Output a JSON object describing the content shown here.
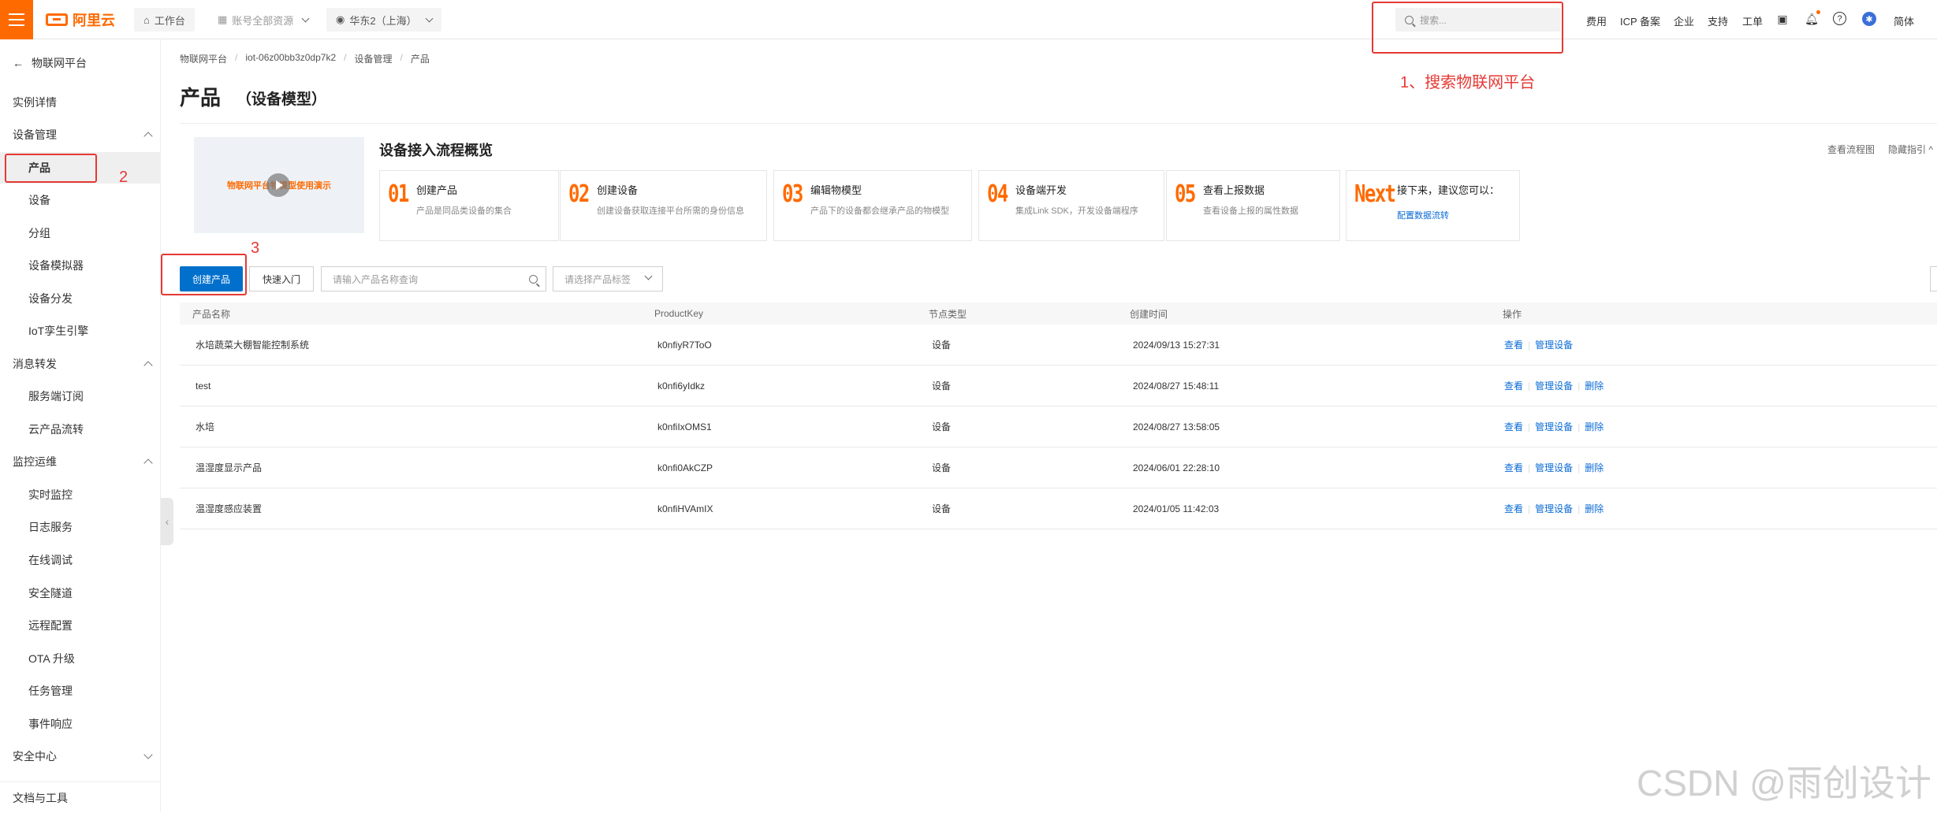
{
  "topbar": {
    "logo_text": "阿里云",
    "workbench": "工作台",
    "account_resources": "账号全部资源",
    "region": "华东2（上海）",
    "search_placeholder": "搜索...",
    "links": [
      "费用",
      "ICP 备案",
      "企业",
      "支持",
      "工单"
    ],
    "language": "简体"
  },
  "sidebar": {
    "back_label": "物联网平台",
    "items": [
      {
        "label": "实例详情",
        "type": "group"
      },
      {
        "label": "设备管理",
        "type": "group",
        "state": "expanded"
      },
      {
        "label": "产品",
        "type": "sub",
        "active": true
      },
      {
        "label": "设备",
        "type": "sub"
      },
      {
        "label": "分组",
        "type": "sub"
      },
      {
        "label": "设备模拟器",
        "type": "sub"
      },
      {
        "label": "设备分发",
        "type": "sub"
      },
      {
        "label": "IoT孪生引擎",
        "type": "sub"
      },
      {
        "label": "消息转发",
        "type": "group",
        "state": "expanded"
      },
      {
        "label": "服务端订阅",
        "type": "sub"
      },
      {
        "label": "云产品流转",
        "type": "sub"
      },
      {
        "label": "监控运维",
        "type": "group",
        "state": "expanded"
      },
      {
        "label": "实时监控",
        "type": "sub"
      },
      {
        "label": "日志服务",
        "type": "sub"
      },
      {
        "label": "在线调试",
        "type": "sub"
      },
      {
        "label": "安全隧道",
        "type": "sub"
      },
      {
        "label": "远程配置",
        "type": "sub"
      },
      {
        "label": "OTA 升级",
        "type": "sub"
      },
      {
        "label": "任务管理",
        "type": "sub"
      },
      {
        "label": "事件响应",
        "type": "sub"
      },
      {
        "label": "安全中心",
        "type": "group",
        "state": "collapsed"
      },
      {
        "label": "文档与工具",
        "type": "group"
      }
    ]
  },
  "breadcrumb": [
    "物联网平台",
    "iot-06z00bb3z0dp7k2",
    "设备管理",
    "产品"
  ],
  "page": {
    "title": "产品",
    "subtitle": "（设备模型）"
  },
  "overview": {
    "video_text": "物联网平台物模型使用演示",
    "title": "设备接入流程概览",
    "view_flow": "查看流程图",
    "hide_guide": "隐藏指引 ^",
    "steps": [
      {
        "num": "01",
        "title": "创建产品",
        "desc": "产品是同品类设备的集合"
      },
      {
        "num": "02",
        "title": "创建设备",
        "desc": "创建设备获取连接平台所需的身份信息"
      },
      {
        "num": "03",
        "title": "编辑物模型",
        "desc": "产品下的设备都会继承产品的物模型"
      },
      {
        "num": "04",
        "title": "设备端开发",
        "desc": "集成Link SDK，开发设备端程序"
      },
      {
        "num": "05",
        "title": "查看上报数据",
        "desc": "查看设备上报的属性数据"
      }
    ],
    "next": {
      "num": "Next",
      "title": "接下来，建议您可以：",
      "link": "配置数据流转"
    }
  },
  "toolbar": {
    "create_label": "创建产品",
    "quick_label": "快速入门",
    "search_placeholder": "请输入产品名称查询",
    "tag_placeholder": "请选择产品标签"
  },
  "table": {
    "headers": [
      "产品名称",
      "ProductKey",
      "节点类型",
      "创建时间",
      "操作"
    ],
    "rows": [
      {
        "name": "水培蔬菜大棚智能控制系统",
        "key": "k0nfiyR7ToO",
        "node": "设备",
        "time": "2024/09/13 15:27:31",
        "ops": [
          "查看",
          "管理设备"
        ]
      },
      {
        "name": "test",
        "key": "k0nfi6yIdkz",
        "node": "设备",
        "time": "2024/08/27 15:48:11",
        "ops": [
          "查看",
          "管理设备",
          "删除"
        ]
      },
      {
        "name": "水培",
        "key": "k0nfiIxOMS1",
        "node": "设备",
        "time": "2024/08/27 13:58:05",
        "ops": [
          "查看",
          "管理设备",
          "删除"
        ]
      },
      {
        "name": "温湿度显示产品",
        "key": "k0nfi0AkCZP",
        "node": "设备",
        "time": "2024/06/01 22:28:10",
        "ops": [
          "查看",
          "管理设备",
          "删除"
        ]
      },
      {
        "name": "温湿度感应装置",
        "key": "k0nfiHVAmIX",
        "node": "设备",
        "time": "2024/01/05 11:42:03",
        "ops": [
          "查看",
          "管理设备",
          "删除"
        ]
      }
    ]
  },
  "annotations": {
    "label1": "1、搜索物联网平台",
    "num2": "2",
    "num3": "3"
  },
  "watermark": "CSDN @雨创设计",
  "colors": {
    "brand": "#ff6a00",
    "primary": "#0070cc",
    "link": "#0b6bd6",
    "annotation": "#e53935"
  }
}
